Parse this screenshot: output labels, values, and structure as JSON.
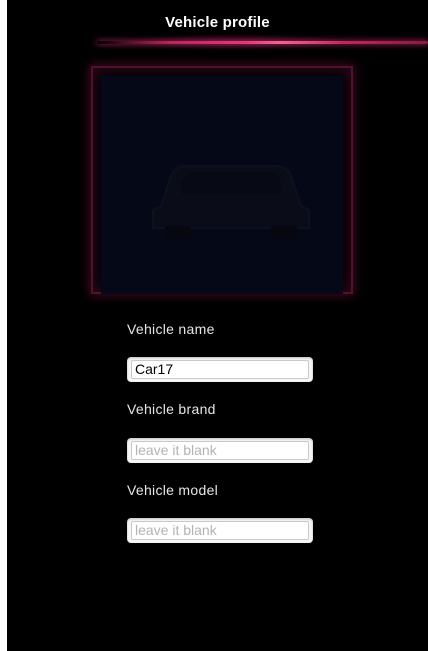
{
  "header": {
    "title": "Vehicle profile"
  },
  "vehicle_photo": {
    "icon": "car-icon"
  },
  "form": {
    "vehicle_name": {
      "label": "Vehicle name",
      "value": "Car17"
    },
    "vehicle_brand": {
      "label": "Vehicle brand",
      "placeholder": "leave it blank"
    },
    "vehicle_model": {
      "label": "Vehicle model",
      "placeholder": "leave it blank"
    }
  },
  "colors": {
    "background": "#000000",
    "accent": "#e8357a",
    "label_text": "#e6e6e6"
  }
}
